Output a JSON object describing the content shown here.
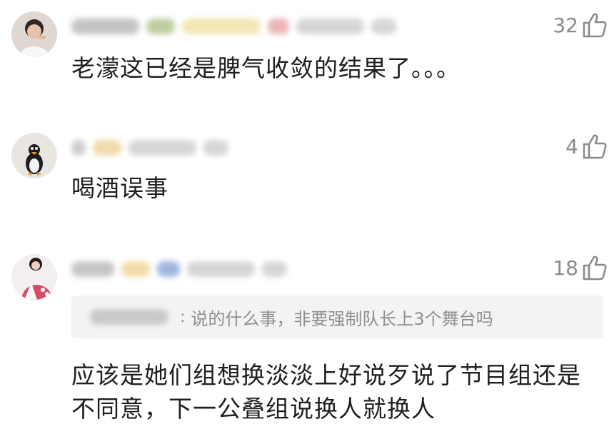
{
  "comments": [
    {
      "like_count": "32",
      "content": "老濛这已经是脾气收敛的结果了。。。",
      "avatar_icon": "user-avatar-icon"
    },
    {
      "like_count": "4",
      "content": "喝酒误事",
      "avatar_icon": "user-avatar-icon"
    },
    {
      "like_count": "18",
      "reply_quote": "说的什么事，非要强制队长上3个舞台吗",
      "reply_sep": ":",
      "content_line1": "应该是她们组想换淡淡上好说歹说了节目组还是",
      "content_line2": "不同意，下一公叠组说换人就换人",
      "avatar_icon": "user-avatar-icon"
    }
  ],
  "colors": {
    "like": "#8a8a8a",
    "reply_bg": "#f3f3f3",
    "reply_text": "#8f8f8f",
    "content_text": "#1f1f1f"
  },
  "icons": {
    "like": "thumbs-up-icon"
  }
}
